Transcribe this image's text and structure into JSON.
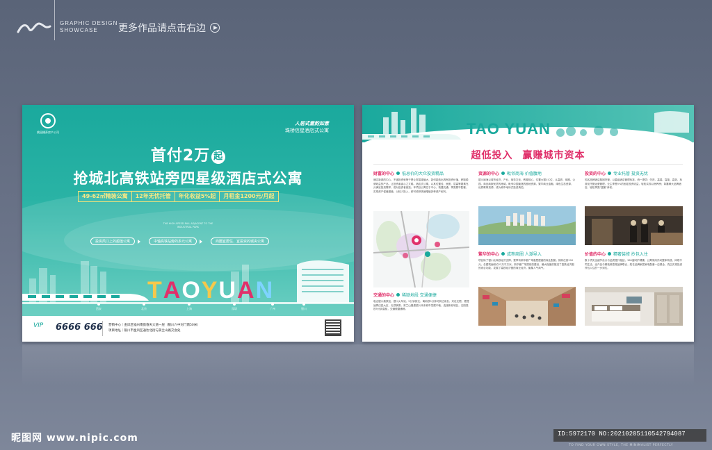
{
  "header": {
    "brand_line1": "GRAPHIC DESIGN",
    "brand_line2": "SHOWCASE",
    "more_link": "更多作品请点击右边"
  },
  "left_poster": {
    "logo_text": "桃园播养房产公司",
    "tagline_slogan": "人居式童韵如意",
    "tagline_sub": "珠桥信星酒店式公寓",
    "headline1": "首付2万",
    "headline1_badge": "起",
    "headline2": "抢城北高铁站旁四星级酒店式公寓",
    "features": [
      "49-62㎡精装公寓",
      "12年无忧托管",
      "年化收益5%起",
      "月租金1200元/月起"
    ],
    "english_line1": "THE HIGH-SPEED RAIL ADJACENT TO THE",
    "english_line2": "INDUSTRIAL PARK",
    "benefits": [
      "投资风口上的超值公寓",
      "中轴高铁站旁的多元公寓",
      "商圈宜居住、宜投资的城央公寓"
    ],
    "brand_word": "TAO YUAN",
    "stations": [
      "西安",
      "北京",
      "上海",
      "深圳",
      "广州",
      "银川"
    ],
    "vip_label": "VIP",
    "phone": "6666 666",
    "sales_center": "营销中心｜金凤区福州南街春天大道一层（银川六中对门南50米）",
    "project_address": "项目地址｜银川市金凤区通达北街与贺兰山路交会处"
  },
  "right_poster": {
    "title_en": "TAO YUAN",
    "slogan_part1": "超低投入",
    "slogan_part2": "赢赚城市资本",
    "sections": [
      {
        "key": "财富的中心",
        "value": "低总价的大众投资精品",
        "text": "通达新城的中心，不错投资就等于是让财富增值大，如何能选出具有投资价值、获取稳健收益的产品，让投资者省心之又稳。酒店式公寓，以其位置佳、面宽、层高等要素充分满足投资需求，成为投资者首选。本项目公寓位于中心、快捷交通，享受繁华配套、实现资产保值增值，以较少投入，即可收获快速增值多种资产权利。"
      },
      {
        "key": "资源的中心",
        "value": "毗邻商海 价值腹地",
        "text": "银川闽海以城市经济、产业、商务文化、教育核心，位置大银川C位，从高铁、商圈、公园、商品商服优质的地域，毗邻中国聚落的圈地资源，繁华商业金融、绿色生态资源、优质教育资源，成为城市地标式投资典范。"
      },
      {
        "key": "投资的中心",
        "value": "专业托管 投资无忧",
        "text": "知名品牌酒店集团托管，以星级酒店管理标准，统一提供：先进、高端、智能、高效、标准化托管运营管理，业主享受5%的固定投资收益，轻松实现以房养房；背靠黄大品牌酒店，轻松享受\"篮筐\"养老。"
      },
      {
        "key": "繁华的中心",
        "value": "成熟商圈 人潮导入",
        "text": "项目除了银川北商铁经济支撑，更享有新华都广场高层配套的商业配套，拥有住房290元，总建筑面积约23万平方米，新华都广场提前的建设，最大程度的推进了高铁经济圈的综合功能、发展了高铁经济圈的商业经济，聚集人气商气。"
      },
      {
        "key": "价值的中心",
        "value": "精奢装修 拎包入住",
        "text": "数十项安全细节设计与品质提升相结，360度呵护健康，公寓采用开间整体构成，体现不同生活，全产品与精装修高端品牌联合，知名品牌家居家电配套一应俱全，真正实现投资拎包入住的一步到位。"
      },
      {
        "key": "交通的中心",
        "value": "稀缺地段 交通便捷",
        "text": "临近银川高铁站、银川火车站，5分钟到达，离雨铁5分钟可到达亲友，来往无限、更提速周边四大区，无须换乘。贺兰山路是银川未来城市发展中轴，连接新老城区，沈阳高铁5分钟直驱，交通便捷通畅。"
      }
    ]
  },
  "watermark": {
    "site": "昵图网 www.nipic.com",
    "id_text": "ID:5972170 NO:20210205110542794087",
    "tagline": "TO FIND YOUR OWN STYLE, THE MINIMALIST PERFECTLY"
  }
}
